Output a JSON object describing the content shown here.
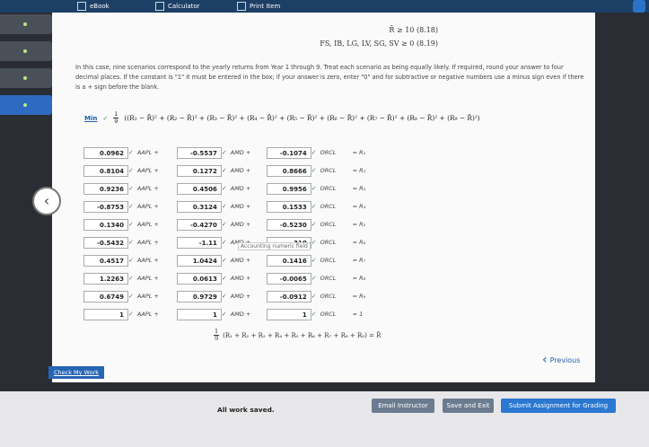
{
  "topbar": {
    "tabs": [
      "eBook",
      "Calculator",
      "Print Item"
    ]
  },
  "equations": {
    "line1": "R̄ ≥ 10 (8.18)",
    "line2": "FS, IB, LG, LV, SG, SV ≥ 0 (8.19)"
  },
  "intro_text": "In this case, nine scenarios correspond to the yearly returns from Year 1 through 9. Treat each scenario as being equally likely. If required, round your answer to four decimal places. If the constant is \"1\" it must be entered in the box; if your answer is zero, enter \"0\" and for subtractive or negative numbers use a minus sign even if there is a + sign before the blank.",
  "objective": {
    "min_label": "Min",
    "frac_num": "1",
    "frac_den": "9",
    "formula": "((R₁ − R̄)² + (R₂ − R̄)² + (R₃ − R̄)² + (R₄ − R̄)² + (R₅ − R̄)² + (R₆ − R̄)² + (R₇ − R̄)² + (R₈ − R̄)² + (R₉ − R̄)²)"
  },
  "constraint_rows": [
    {
      "aapl": "0.0962",
      "amd": "-0.5537",
      "orcl": "-0.1074",
      "r": "= R₁"
    },
    {
      "aapl": "0.8104",
      "amd": "0.1272",
      "orcl": "0.8666",
      "r": "= R₂"
    },
    {
      "aapl": "0.9236",
      "amd": "0.4506",
      "orcl": "0.9956",
      "r": "= R₃"
    },
    {
      "aapl": "-0.8753",
      "amd": "0.3124",
      "orcl": "0.1533",
      "r": "= R₄"
    },
    {
      "aapl": "0.1340",
      "amd": "-0.4270",
      "orcl": "-0.5230",
      "r": "= R₅"
    },
    {
      "aapl": "-0.5432",
      "amd": "-1.11",
      "orcl": "310",
      "r": "= R₆"
    },
    {
      "aapl": "0.4517",
      "amd": "1.0424",
      "orcl": "0.1416",
      "r": "= R₇"
    },
    {
      "aapl": "1.2263",
      "amd": "0.0613",
      "orcl": "-0.0065",
      "r": "= R₈"
    },
    {
      "aapl": "0.6749",
      "amd": "0.9729",
      "orcl": "-0.0912",
      "r": "= R₉"
    },
    {
      "aapl": "1",
      "amd": "1",
      "orcl": "1",
      "r": "= 1"
    }
  ],
  "labels": {
    "aapl": "AAPL +",
    "amd": "AMD +",
    "orcl": "ORCL",
    "check": "✓"
  },
  "tooltip": "Accounting numeric field",
  "average": {
    "num": "1",
    "den": "9",
    "expr": "(R₁ + R₂ + R₃ + R₄ + R₅ + R₆ + R₇ + R₈ + R₉) = R̄"
  },
  "nav": {
    "previous": "Previous",
    "check_work": "Check My Work"
  },
  "footer": {
    "status": "All work saved.",
    "email": "Email Instructor",
    "save_exit": "Save and Exit",
    "submit": "Submit Assignment for Grading"
  }
}
